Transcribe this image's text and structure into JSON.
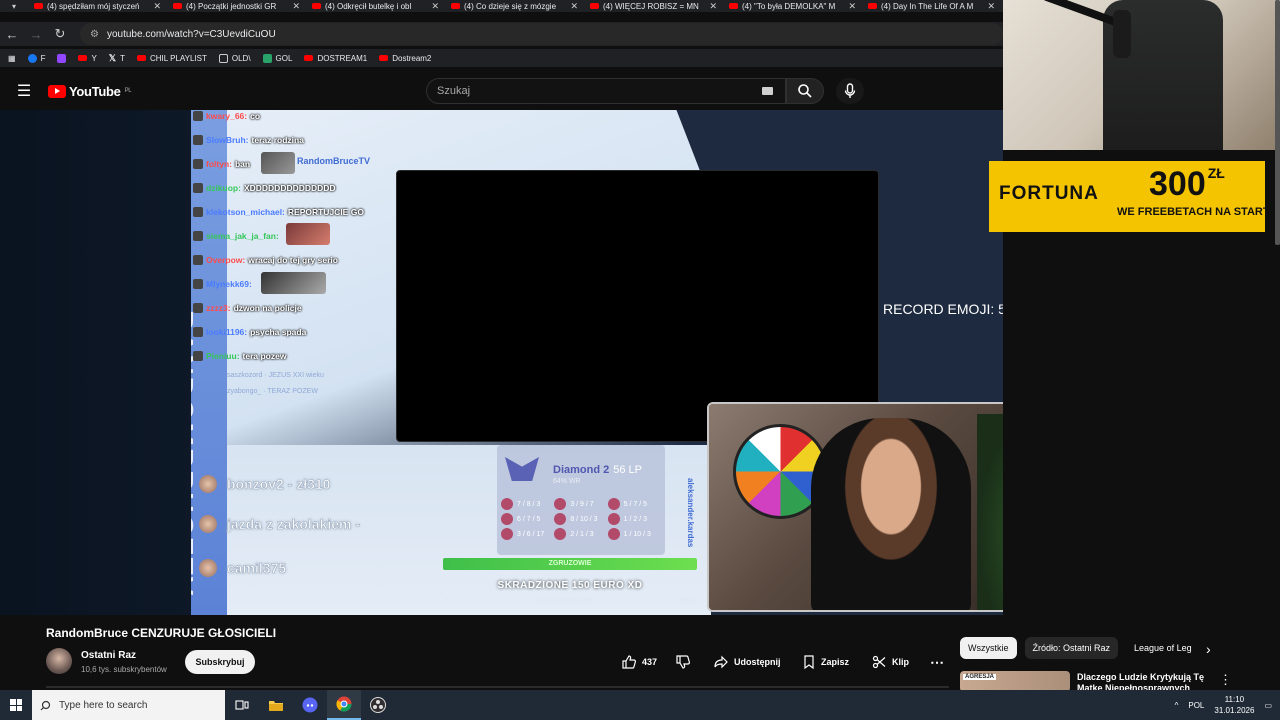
{
  "browser": {
    "tabs": [
      {
        "title": "(4) spędziłam mój styczeń"
      },
      {
        "title": "(4) Początki jednostki GR"
      },
      {
        "title": "(4) Odkręcił butelkę i obl"
      },
      {
        "title": "(4) Co dzieje się z mózgie"
      },
      {
        "title": "(4) WIĘCEJ ROBISZ = MN"
      },
      {
        "title": "(4) \"To była DEMOLKA\" M"
      },
      {
        "title": "(4) Day In The Life Of A M"
      }
    ],
    "url": "youtube.com/watch?v=C3UevdiCuOU",
    "bookmarks": [
      {
        "label": "F",
        "color": "#1877f2"
      },
      {
        "label": "",
        "color": "#9146ff"
      },
      {
        "label": "Y",
        "color": "#ff0000"
      },
      {
        "label": "T",
        "color": "#ffffff"
      },
      {
        "label": "CHIL PLAYLIST",
        "color": "#ff0000"
      },
      {
        "label": "OLD\\",
        "color": "#cccccc"
      },
      {
        "label": "GOL",
        "color": "#2aa36b"
      },
      {
        "label": "DOSTREAM1",
        "color": "#ff0000"
      },
      {
        "label": "Dostream2",
        "color": "#ff0000"
      }
    ]
  },
  "youtube": {
    "logo_text": "YouTube",
    "region": "PL",
    "search_placeholder": "Szukaj"
  },
  "stream": {
    "chat": [
      {
        "user": "kwary_66:",
        "msg": "co",
        "color": "#ff4b4b"
      },
      {
        "user": "SlowBruh:",
        "msg": "teraz rodzina",
        "color": "#4b7bff"
      },
      {
        "user": "foltyn:",
        "msg": "ban",
        "color": "#ff4b4b"
      },
      {
        "user": "dzikuop:",
        "msg": "XDDDDDDDDDDDDDD",
        "color": "#34c759"
      },
      {
        "user": "klekotson_michael:",
        "msg": "REPORTUJCIE GO",
        "color": "#4b7bff"
      },
      {
        "user": "siema_jak_ja_fan:",
        "msg": "",
        "color": "#34c759"
      },
      {
        "user": "Overpow:",
        "msg": "wracaj do tej gry serio",
        "color": "#ff4b4b"
      },
      {
        "user": "Mlynekk69:",
        "msg": "",
        "color": "#4b7bff"
      },
      {
        "user": "zzzz3:",
        "msg": "dzwon na policje",
        "color": "#ff4b4b"
      },
      {
        "user": "looki1196:",
        "msg": "psycha spada",
        "color": "#4b7bff"
      },
      {
        "user": "Pieniuu:",
        "msg": "tera pozew",
        "color": "#34c759"
      }
    ],
    "chat_watermark": "RandomBruceTV",
    "faded_chat": [
      {
        "user": "saszkozord",
        "msg": "JEZUS XXI wieku"
      },
      {
        "user": "zyabongo_",
        "msg": "TERAZ POZEW"
      }
    ],
    "vertical_brand": "RANDOMBRUCETV",
    "record_text": "RECORD EMOJI: 51777 KEKW",
    "donors": [
      "bonzov2 - zł310",
      "jazda z zakolakiem -",
      "camil375"
    ],
    "rank": {
      "tier": "Diamond 2",
      "lp": "56 LP",
      "winrate": "64% WR",
      "matches": [
        "7 / 8 / 3",
        "3 / 9 / 7",
        "5 / 7 / 5",
        "6 / 7 / 5",
        "8 / 10 / 3",
        "1 / 2 / 3",
        "3 / 6 / 17",
        "2 / 1 / 3",
        "1 / 10 / 3"
      ]
    },
    "side_name": "aleksander.kardas",
    "goal": {
      "label": "ZGRUZOWIE",
      "text": "SKRADZIONE 150 EURO XD",
      "start": "0",
      "current": "zł3,023.69(504%)",
      "target": "zł600",
      "progress": 1.0
    },
    "ad": {
      "brand": "FORTUNA",
      "amount": "300",
      "currency": "ZŁ",
      "subtitle": "WE FREEBETACH NA START"
    }
  },
  "video": {
    "title": "RandomBruce CENZURUJE GŁOSICIELI",
    "channel": "Ostatni Raz",
    "subscribers": "10,6 tys. subskrybentów",
    "subscribe_label": "Subskrybuj",
    "likes": "437",
    "share_label": "Udostępnij",
    "save_label": "Zapisz",
    "clip_label": "Klip"
  },
  "sidebar": {
    "chips": [
      "Wszystkie",
      "Źródło: Ostatni Raz",
      "League of Leg"
    ],
    "recommended": {
      "thumb_text": "AGRESJA",
      "title": "Dlaczego Ludzie Krytykują Tę Matkę Niepełnosprawnych"
    }
  },
  "taskbar": {
    "search_placeholder": "Type here to search",
    "language": "POL",
    "time": "11:10",
    "date": "31.01.2026"
  }
}
